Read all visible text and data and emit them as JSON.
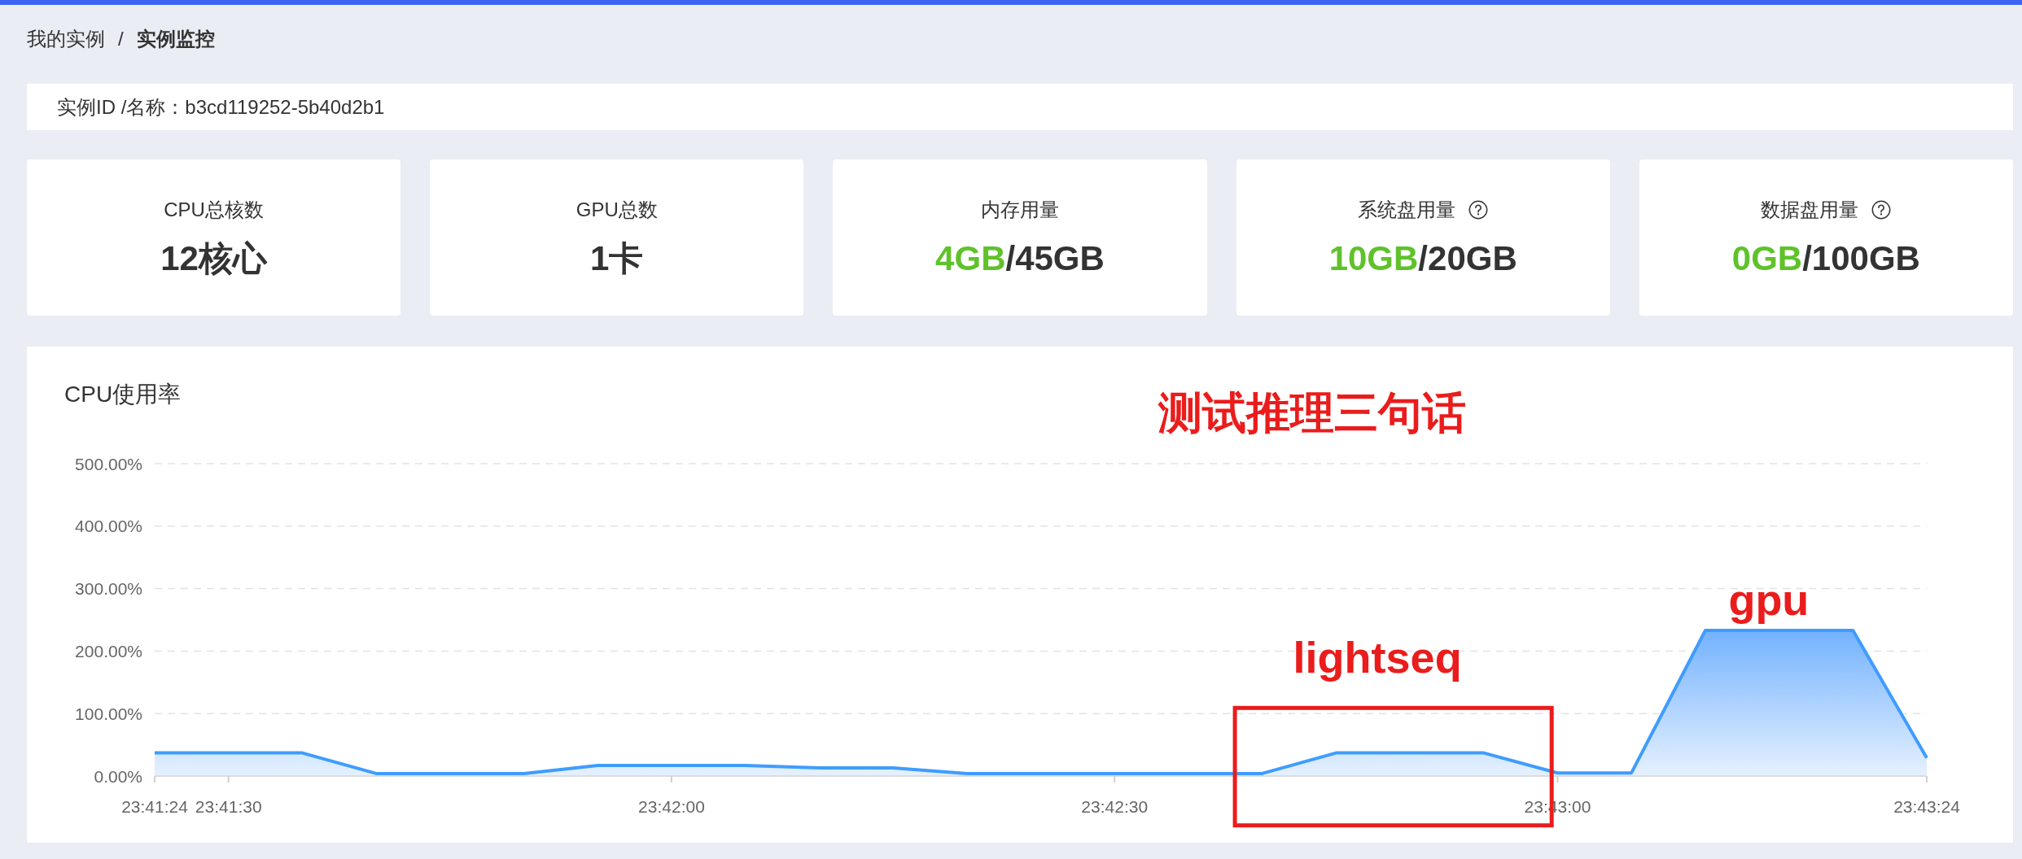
{
  "breadcrumb": {
    "separator": "/",
    "items": [
      {
        "label": "我的实例",
        "current": false
      },
      {
        "label": "实例监控",
        "current": true
      }
    ]
  },
  "instance_info": {
    "text": "实例ID /名称：b3cd119252-5b40d2b1"
  },
  "stats": [
    {
      "kind": "total",
      "label": "CPU总核数",
      "value": "12核心",
      "help": false
    },
    {
      "kind": "total",
      "label": "GPU总数",
      "value": "1卡",
      "help": false
    },
    {
      "kind": "usage",
      "label": "内存用量",
      "used": "4GB",
      "total": "/45GB",
      "help": false
    },
    {
      "kind": "usage",
      "label": "系统盘用量",
      "used": "10GB",
      "total": "/20GB",
      "help": true
    },
    {
      "kind": "usage",
      "label": "数据盘用量",
      "used": "0GB",
      "total": "/100GB",
      "help": true
    }
  ],
  "chart": {
    "chart_data": {
      "type": "area",
      "title": "CPU使用率",
      "grid": true,
      "categories": [
        "23:41:24",
        "23:41:30",
        null,
        null,
        null,
        null,
        null,
        "23:42:00",
        null,
        null,
        null,
        null,
        null,
        "23:42:30",
        null,
        null,
        null,
        null,
        null,
        "23:43:00",
        null,
        null,
        null,
        null,
        "23:43:24"
      ],
      "values": [
        37,
        37,
        37,
        4,
        4,
        4,
        17,
        17,
        17,
        13,
        13,
        4,
        4,
        4,
        4,
        4,
        37,
        37,
        37,
        5,
        5,
        233,
        233,
        233,
        29
      ],
      "ylim": [
        0,
        500
      ],
      "yticks": [
        {
          "value": 0,
          "label": "0.00%"
        },
        {
          "value": 100,
          "label": "100.00%"
        },
        {
          "value": 200,
          "label": "200.00%"
        },
        {
          "value": 300,
          "label": "300.00%"
        },
        {
          "value": 400,
          "label": "400.00%"
        },
        {
          "value": 500,
          "label": "500.00%"
        }
      ],
      "annotations": [
        "测试推理三句话",
        "lightseq",
        "gpu"
      ]
    }
  }
}
